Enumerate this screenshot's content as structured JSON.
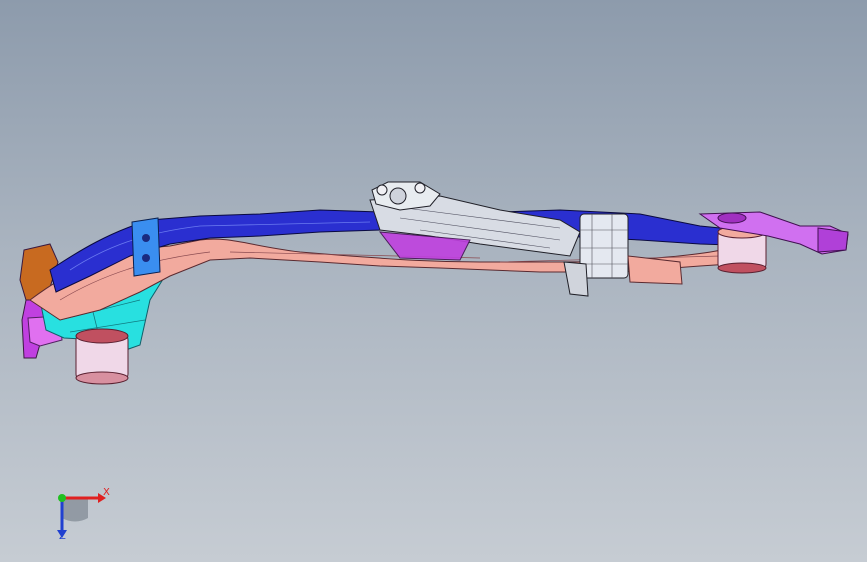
{
  "viewport": {
    "background_top": "#8d9bac",
    "background_bottom": "#c6ccd3"
  },
  "model": {
    "name_icon": "suspension-subframe-model",
    "colors": {
      "blue": "#2a2fd0",
      "salmon": "#f2aa9e",
      "cyan": "#28e0e0",
      "magenta": "#c040e0",
      "silver": "#d8dce4",
      "orange": "#c86a20"
    }
  },
  "triad": {
    "x_label": "X",
    "z_label": "Z",
    "x_color": "#e02020",
    "y_color": "#20c020",
    "z_color": "#2040d0"
  }
}
